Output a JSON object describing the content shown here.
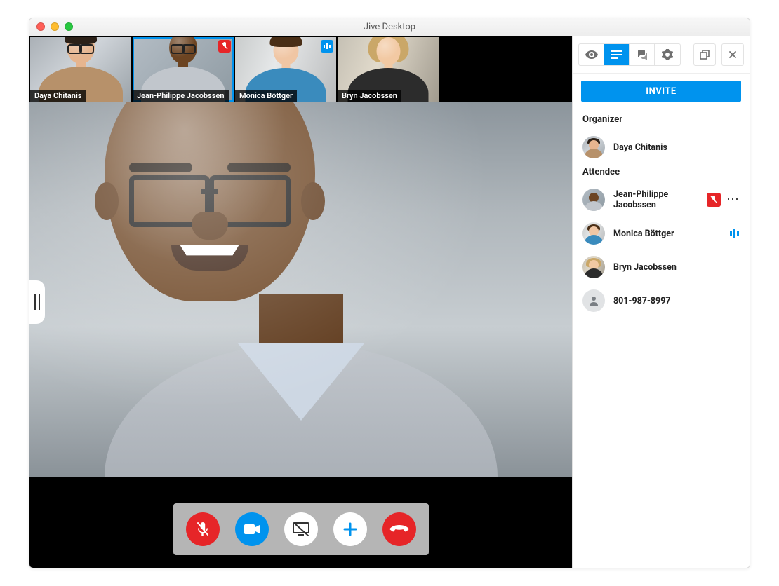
{
  "window": {
    "title": "Jive Desktop"
  },
  "filmstrip": [
    {
      "name": "Daya Chitanis"
    },
    {
      "name": "Jean-Philippe Jacobssen",
      "active": true,
      "muted": true
    },
    {
      "name": "Monica Böttger",
      "speaking": true
    },
    {
      "name": "Bryn Jacobssen"
    }
  ],
  "controls": {
    "mic": "mic-muted",
    "camera": "camera-on",
    "share": "screenshare",
    "add": "add-participant",
    "hangup": "hang-up"
  },
  "sidebar": {
    "invite_label": "INVITE",
    "sections": {
      "organizer_title": "Organizer",
      "attendee_title": "Attendee"
    },
    "organizer": {
      "name": "Daya Chitanis"
    },
    "attendees": [
      {
        "name": "Jean-Philippe Jacobssen",
        "muted": true,
        "more": true
      },
      {
        "name": "Monica Böttger",
        "speaking": true
      },
      {
        "name": "Bryn Jacobssen"
      },
      {
        "name": "801-987-8997",
        "generic": true
      }
    ]
  }
}
